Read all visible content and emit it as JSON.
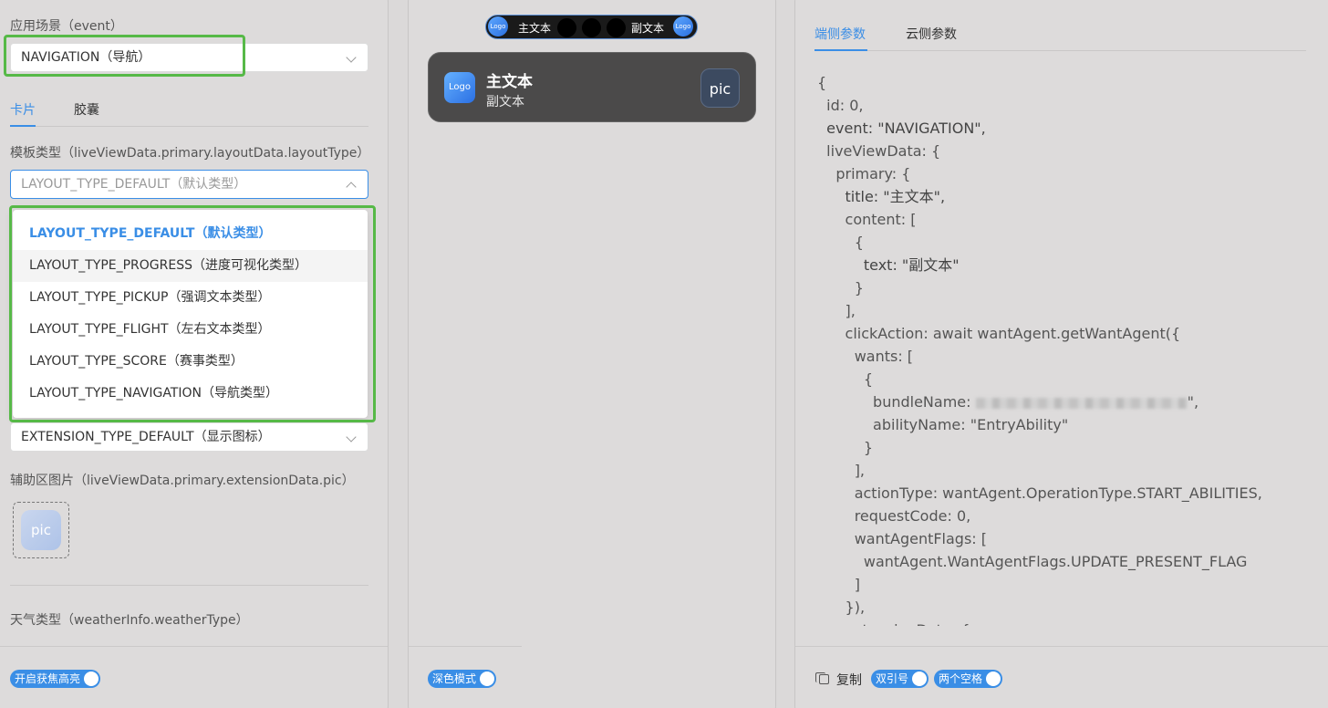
{
  "left": {
    "scene_label": "应用场景（event）",
    "scene_value": "NAVIGATION（导航）",
    "tabs": [
      "卡片",
      "胶囊"
    ],
    "template_label": "模板类型（liveViewData.primary.layoutData.layoutType）",
    "template_placeholder": "LAYOUT_TYPE_DEFAULT（默认类型）",
    "dropdown_options": [
      "LAYOUT_TYPE_DEFAULT（默认类型）",
      "LAYOUT_TYPE_PROGRESS（进度可视化类型）",
      "LAYOUT_TYPE_PICKUP（强调文本类型）",
      "LAYOUT_TYPE_FLIGHT（左右文本类型）",
      "LAYOUT_TYPE_SCORE（赛事类型）",
      "LAYOUT_TYPE_NAVIGATION（导航类型）"
    ],
    "extension_value": "EXTENSION_TYPE_DEFAULT（显示图标）",
    "pic_label": "辅助区图片（liveViewData.primary.extensionData.pic）",
    "pic_text": "pic",
    "weather_label": "天气类型（weatherInfo.weatherType）",
    "focus_toggle": "开启获焦高亮"
  },
  "middle": {
    "capsule": {
      "logo": "Logo",
      "main": "主文本",
      "sub": "副文本"
    },
    "card": {
      "logo": "Logo",
      "title": "主文本",
      "subtitle": "副文本",
      "pic": "pic"
    },
    "dark_toggle": "深色模式"
  },
  "right": {
    "tabs": [
      "端侧参数",
      "云侧参数"
    ],
    "code_lines": [
      "{",
      "  id: 0,",
      "  event: \"NAVIGATION\",",
      "  liveViewData: {",
      "    primary: {",
      "      title: \"主文本\",",
      "      content: [",
      "        {",
      "          text: \"副文本\"",
      "        }",
      "      ],",
      "      clickAction: await wantAgent.getWantAgent({",
      "        wants: [",
      "          {",
      "            bundleName: ",
      "            abilityName: \"EntryAbility\"",
      "          }",
      "        ],",
      "        actionType: wantAgent.OperationType.START_ABILITIES,",
      "        requestCode: 0,",
      "        wantAgentFlags: [",
      "          wantAgent.WantAgentFlags.UPDATE_PRESENT_FLAG",
      "        ]",
      "      }),",
      "      extensionData: {"
    ],
    "bundle_suffix": "\",",
    "copy_label": "复制",
    "quote_toggle": "双引号",
    "space_toggle": "两个空格"
  },
  "colors": {
    "accent": "#3a8ee6",
    "highlight": "#56b947",
    "card": "#4b4a4a"
  }
}
